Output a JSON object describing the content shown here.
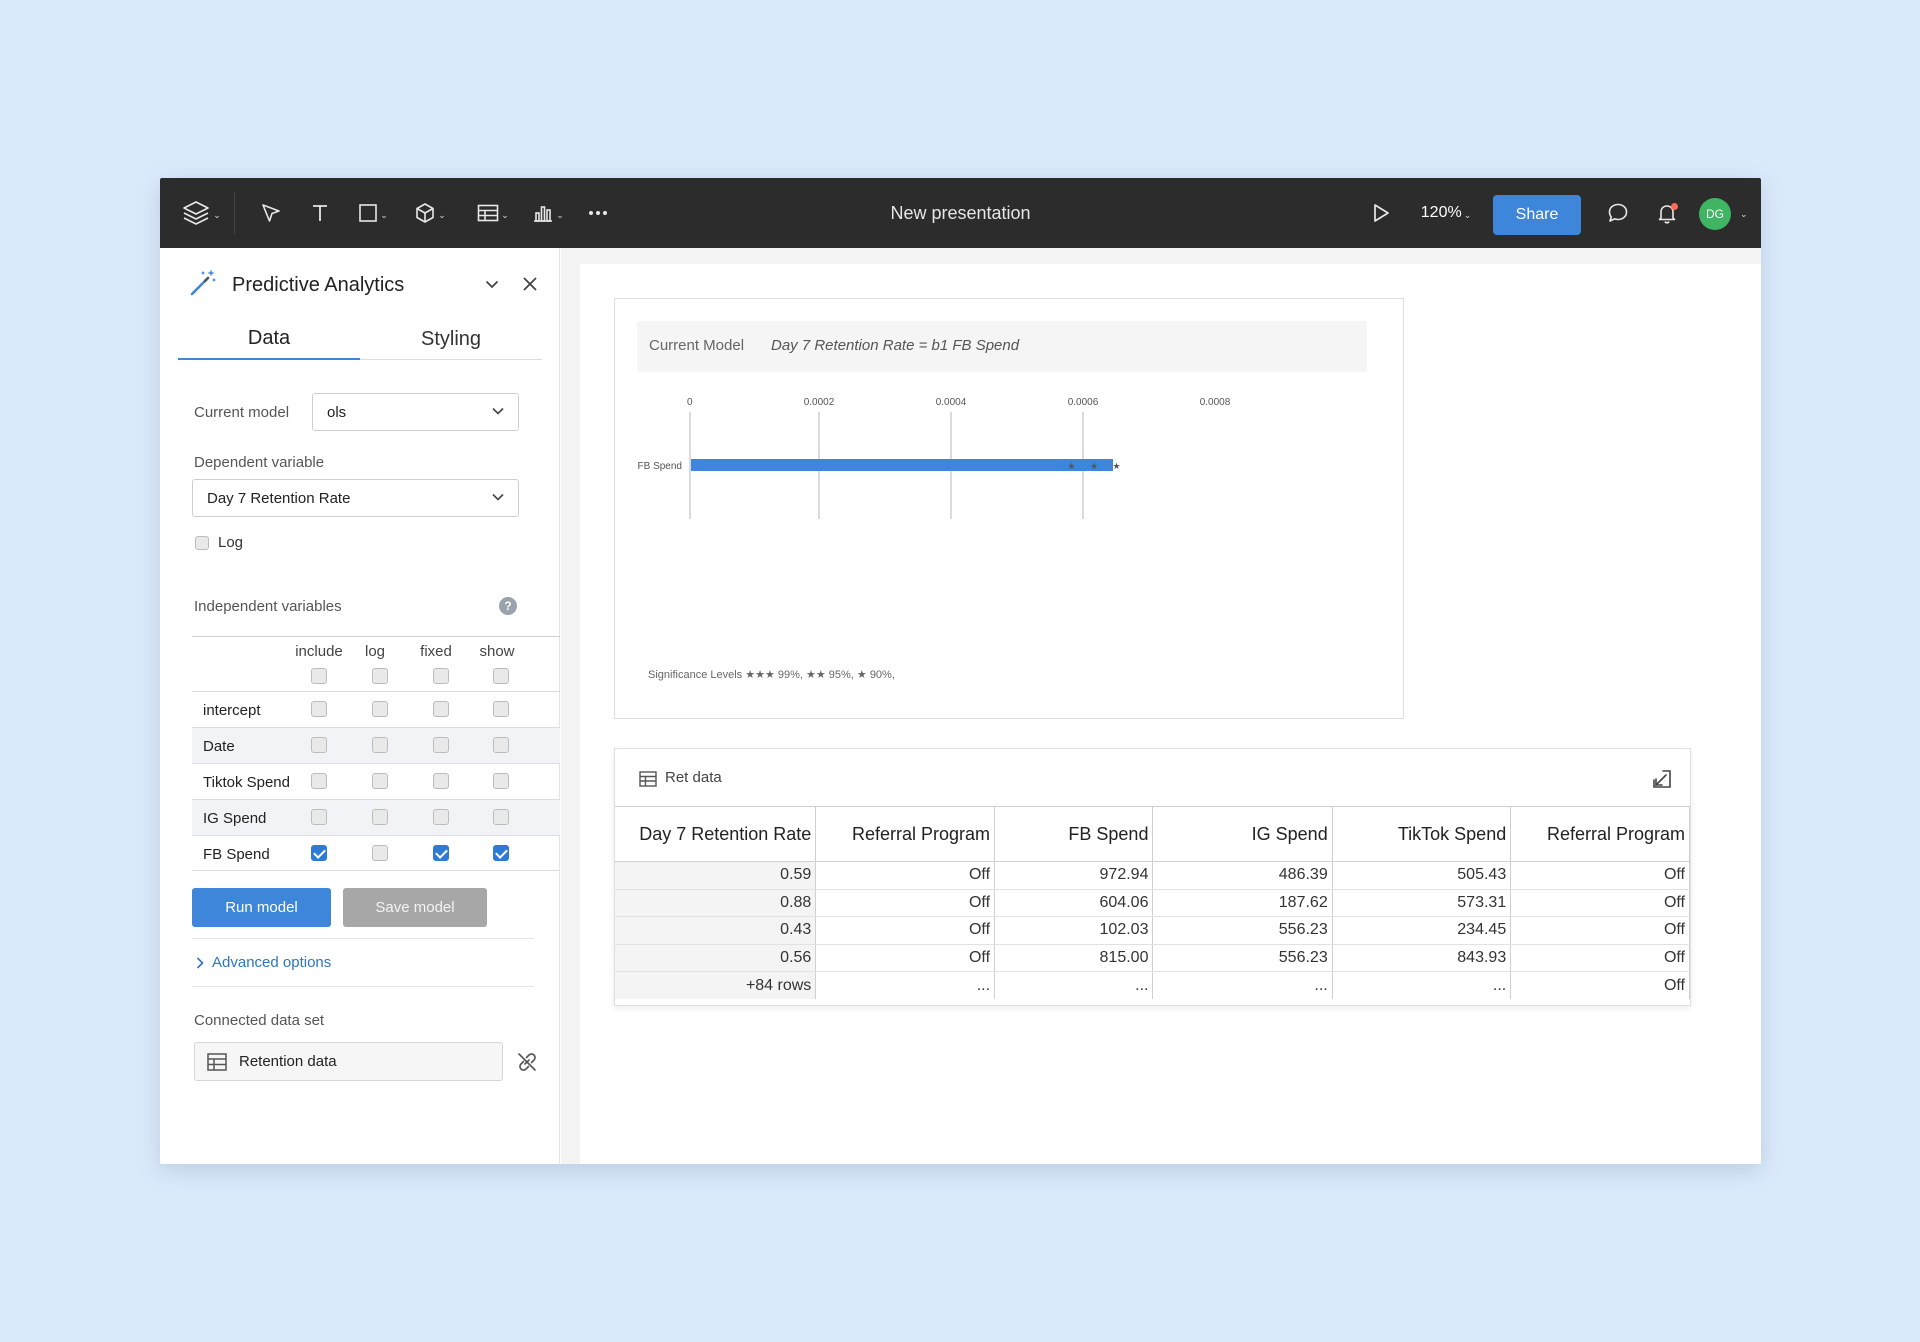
{
  "toolbar": {
    "title": "New presentation",
    "zoom": "120%",
    "share_label": "Share",
    "avatar_initials": "DG",
    "icons": [
      "layers-icon",
      "pointer-icon",
      "text-icon",
      "rectangle-icon",
      "cube-icon",
      "table-icon",
      "chart-icon",
      "more-icon",
      "play-icon",
      "comment-icon",
      "bell-icon"
    ]
  },
  "panel": {
    "title": "Predictive Analytics",
    "tabs": [
      {
        "label": "Data",
        "active": true
      },
      {
        "label": "Styling",
        "active": false
      }
    ],
    "current_model_label": "Current model",
    "current_model_value": "ols",
    "dependent_label": "Dependent variable",
    "dependent_value": "Day 7 Retention Rate",
    "log_label": "Log",
    "independent_label": "Independent variables",
    "help_glyph": "?",
    "columns": [
      "include",
      "log",
      "fixed",
      "show"
    ],
    "variables": [
      {
        "name": "intercept",
        "include": false,
        "log": false,
        "fixed": false,
        "show": false
      },
      {
        "name": "Date",
        "include": false,
        "log": false,
        "fixed": false,
        "show": false
      },
      {
        "name": "Tiktok Spend",
        "include": false,
        "log": false,
        "fixed": false,
        "show": false
      },
      {
        "name": "IG Spend",
        "include": false,
        "log": false,
        "fixed": false,
        "show": false
      },
      {
        "name": "FB Spend",
        "include": true,
        "log": false,
        "fixed": true,
        "show": true
      }
    ],
    "run_label": "Run model",
    "save_label": "Save model",
    "advanced_label": "Advanced options",
    "dataset_label": "Connected data set",
    "dataset_value": "Retention data"
  },
  "chart": {
    "model_label": "Current Model",
    "equation": "Day 7 Retention Rate =  b1 FB Spend",
    "significance": "Significance Levels  ★★★ 99%, ★★ 95%, ★ 90%,",
    "bar_stars": "★ ★ ★"
  },
  "chart_data": {
    "type": "bar",
    "orientation": "horizontal",
    "categories": [
      "FB Spend"
    ],
    "values": [
      0.0006
    ],
    "x_ticks": [
      "0",
      "0.0002",
      "0.0004",
      "0.0006",
      "0.0008"
    ],
    "xlim": [
      0,
      0.0008
    ],
    "title": "",
    "xlabel": "",
    "ylabel": "",
    "grid": true,
    "bar_color": "#3d86d9"
  },
  "data_table": {
    "title": "Ret data",
    "columns": [
      "Day 7 Retention Rate",
      "Referral Program",
      "FB Spend",
      "IG Spend",
      "TikTok Spend",
      "Referral Program"
    ],
    "rows": [
      [
        "0.59",
        "Off",
        "972.94",
        "486.39",
        "505.43",
        "Off"
      ],
      [
        "0.88",
        "Off",
        "604.06",
        "187.62",
        "573.31",
        "Off"
      ],
      [
        "0.43",
        "Off",
        "102.03",
        "556.23",
        "234.45",
        "Off"
      ],
      [
        "0.56",
        "Off",
        "815.00",
        "556.23",
        "843.93",
        "Off"
      ],
      [
        "+84 rows",
        "...",
        "...",
        "...",
        "...",
        "Off"
      ]
    ]
  },
  "colors": {
    "accent": "#3d86d9",
    "toolbar_bg": "#2c2c2c",
    "page_bg": "#dbeafb",
    "avatar": "#3fb463"
  }
}
